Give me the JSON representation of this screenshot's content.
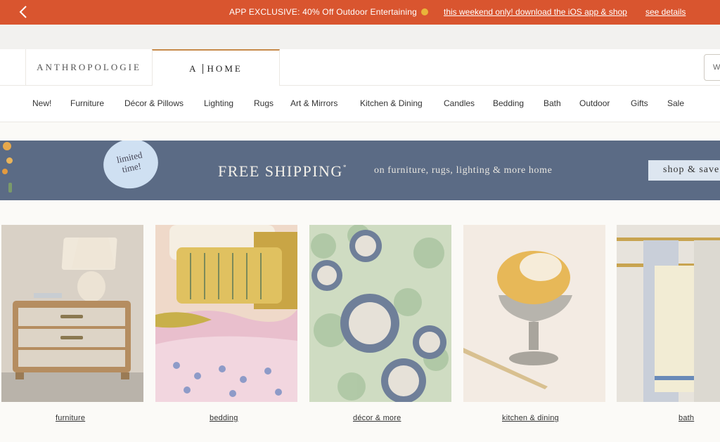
{
  "promo": {
    "main_text": "APP EXCLUSIVE: 40% Off Outdoor Entertaining",
    "link_app": "this weekend only! download the iOS app & shop",
    "link_details": "see details"
  },
  "brands": {
    "anthropologie": "ANTHROPOLOGIE",
    "home_a": "A",
    "home_word": "HOME",
    "search_stub": "W"
  },
  "categories": [
    "New!",
    "Furniture",
    "Décor & Pillows",
    "Lighting",
    "Rugs",
    "Art & Mirrors",
    "Kitchen & Dining",
    "Candles",
    "Bedding",
    "Bath",
    "Outdoor",
    "Gifts",
    "Sale"
  ],
  "banner": {
    "badge_line1": "limited",
    "badge_line2": "time!",
    "title": "FREE SHIPPING",
    "asterisk": "*",
    "subtitle": "on furniture, rugs, lighting & more home",
    "cta": "shop & save"
  },
  "tiles": [
    {
      "label": "furniture"
    },
    {
      "label": "bedding"
    },
    {
      "label": "décor & more"
    },
    {
      "label": "kitchen & dining"
    },
    {
      "label": "bath"
    }
  ],
  "colors": {
    "promo_bg": "#d9552f",
    "banner_bg": "#5b6b85",
    "accent_tab": "#c78a4a",
    "badge_bg": "#cfe0f2"
  }
}
